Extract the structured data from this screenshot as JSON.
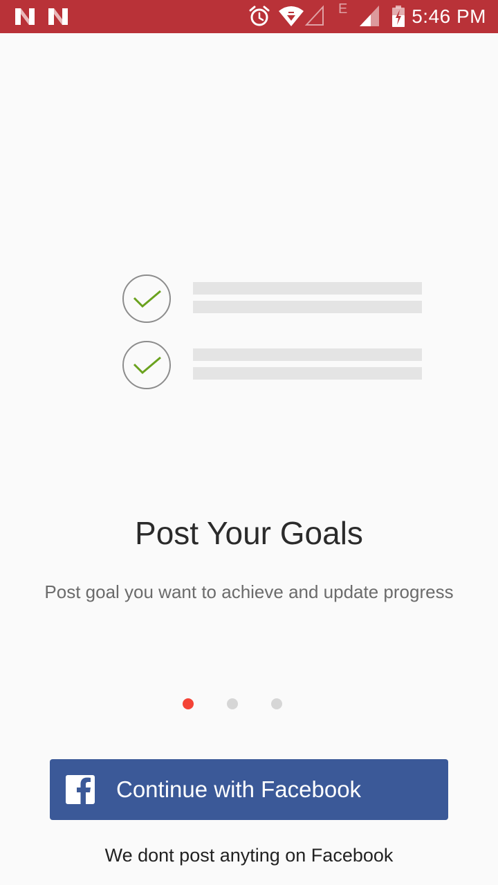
{
  "status_bar": {
    "time": "5:46 PM",
    "network_letter": "E",
    "icons": [
      "n-notification-icon",
      "n-notification-icon",
      "alarm-icon",
      "wifi-icon",
      "signal-empty-icon",
      "signal-icon",
      "battery-charging-icon"
    ],
    "background_color": "#b93238"
  },
  "illustration": {
    "items": [
      {
        "icon": "check-icon",
        "checked": true
      },
      {
        "icon": "check-icon",
        "checked": true
      }
    ],
    "check_color": "#6aa21e"
  },
  "onboarding": {
    "title": "Post Your Goals",
    "subtitle": "Post goal you want to achieve and update progress",
    "page_count": 3,
    "current_page": 1
  },
  "facebook_button": {
    "label": "Continue with Facebook",
    "icon": "facebook-icon",
    "color": "#3b5998"
  },
  "footer": {
    "note": "We dont post anyting on Facebook"
  },
  "accent_color": "#f44336"
}
